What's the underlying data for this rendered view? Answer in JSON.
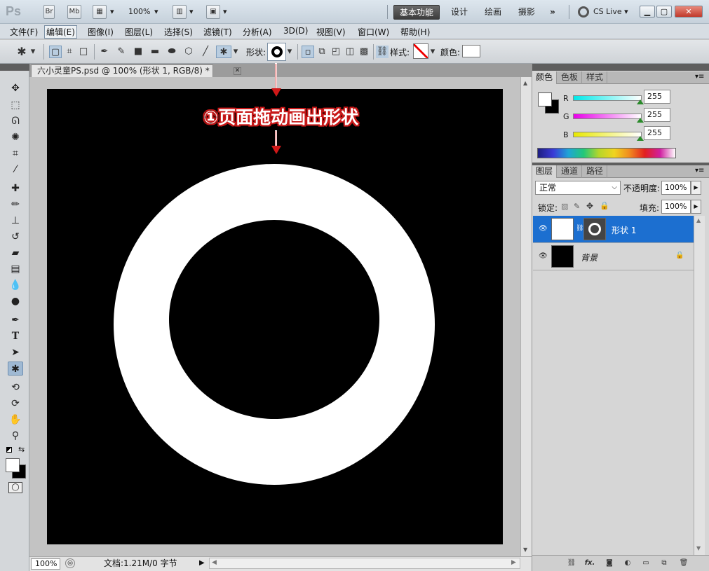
{
  "titlebar": {
    "logo": "Ps",
    "bridge": "Br",
    "minibridge": "Mb",
    "zoom": "100%",
    "workspaces": [
      "基本功能",
      "设计",
      "绘画",
      "摄影"
    ],
    "more": "»",
    "cs_live": "CS Live"
  },
  "menu": [
    "文件(F)",
    "编辑(E)",
    "图像(I)",
    "图层(L)",
    "选择(S)",
    "滤镜(T)",
    "分析(A)",
    "3D(D)",
    "视图(V)",
    "窗口(W)",
    "帮助(H)"
  ],
  "options": {
    "shape_label": "形状:",
    "style_label": "样式:",
    "color_label": "颜色:"
  },
  "document": {
    "tab_title": "六小灵童PS.psd @ 100% (形状 1, RGB/8) *",
    "zoom": "100%",
    "info": "文档:1.21M/0 字节",
    "canvas_color": "#000000",
    "shape_color": "#ffffff"
  },
  "annotation": {
    "text": "①页面拖动画出形状",
    "color": "#d01818"
  },
  "color_panel": {
    "tabs": [
      "颜色",
      "色板",
      "样式"
    ],
    "channels": [
      {
        "label": "R",
        "value": "255",
        "grad": "#00e8e8"
      },
      {
        "label": "G",
        "value": "255",
        "grad": "#e800e8"
      },
      {
        "label": "B",
        "value": "255",
        "grad": "#e8e800"
      }
    ]
  },
  "layers_panel": {
    "tabs": [
      "图层",
      "通道",
      "路径"
    ],
    "blend_mode": "正常",
    "opacity_label": "不透明度:",
    "opacity": "100%",
    "lock_label": "锁定:",
    "fill_label": "填充:",
    "fill": "100%",
    "layers": [
      {
        "name": "形状 1",
        "selected": true
      },
      {
        "name": "背景",
        "selected": false
      }
    ],
    "selection_color": "#1c6fd0"
  }
}
